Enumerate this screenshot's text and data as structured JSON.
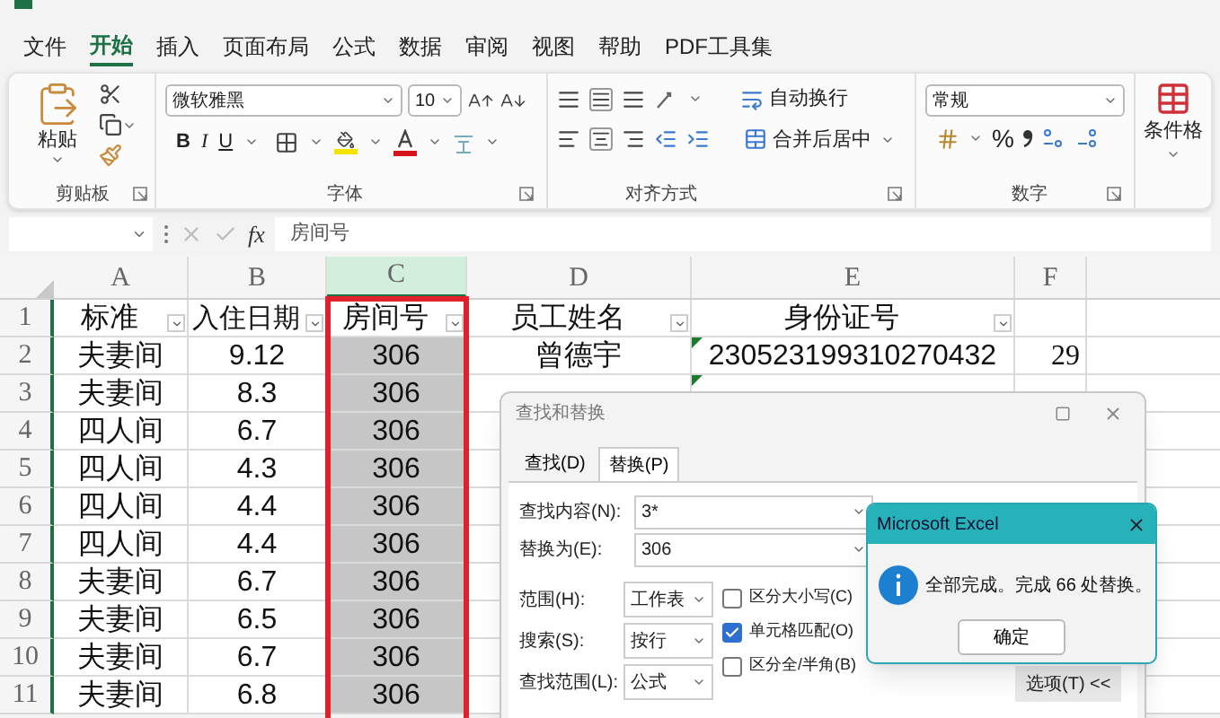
{
  "menu_tabs": [
    {
      "label": "文件",
      "selected": false
    },
    {
      "label": "开始",
      "selected": true
    },
    {
      "label": "插入",
      "selected": false
    },
    {
      "label": "页面布局",
      "selected": false
    },
    {
      "label": "公式",
      "selected": false
    },
    {
      "label": "数据",
      "selected": false
    },
    {
      "label": "审阅",
      "selected": false
    },
    {
      "label": "视图",
      "selected": false
    },
    {
      "label": "帮助",
      "selected": false
    },
    {
      "label": "PDF工具集",
      "selected": false
    }
  ],
  "ribbon": {
    "clipboard": {
      "paste": "粘贴",
      "group": "剪贴板"
    },
    "font": {
      "font_name": "微软雅黑",
      "font_size": "10",
      "bold": "B",
      "italic": "I",
      "underline": "U",
      "group": "字体"
    },
    "alignment": {
      "wrap": "自动换行",
      "merge": "合并后居中",
      "group": "对齐方式"
    },
    "number": {
      "format": "常规",
      "percent": "%",
      "group": "数字"
    },
    "styles": {
      "conditional": "条件格"
    }
  },
  "formula_bar": {
    "fx": "fx",
    "value": "房间号"
  },
  "sheet": {
    "columns": [
      {
        "label": "A",
        "selected": false
      },
      {
        "label": "B",
        "selected": false
      },
      {
        "label": "C",
        "selected": true
      },
      {
        "label": "D",
        "selected": false
      },
      {
        "label": "E",
        "selected": false
      },
      {
        "label": "F",
        "selected": false
      }
    ],
    "header_row": {
      "num": "1",
      "filter": true,
      "cells": [
        "标准",
        "入住日期",
        "房间号",
        "员工姓名",
        "身份证号"
      ]
    },
    "rows": [
      {
        "num": "2",
        "error_mark": true,
        "cells": [
          "夫妻间",
          "9.12",
          "306",
          "曾德宇",
          "230523199310270432",
          "29"
        ]
      },
      {
        "num": "3",
        "error_mark": true,
        "cells": [
          "夫妻间",
          "8.3",
          "306"
        ]
      },
      {
        "num": "4",
        "cells": [
          "四人间",
          "6.7",
          "306"
        ]
      },
      {
        "num": "5",
        "cells": [
          "四人间",
          "4.3",
          "306"
        ]
      },
      {
        "num": "6",
        "cells": [
          "四人间",
          "4.4",
          "306"
        ]
      },
      {
        "num": "7",
        "cells": [
          "四人间",
          "4.4",
          "306"
        ]
      },
      {
        "num": "8",
        "cells": [
          "夫妻间",
          "6.7",
          "306"
        ]
      },
      {
        "num": "9",
        "cells": [
          "夫妻间",
          "6.5",
          "306"
        ]
      },
      {
        "num": "10",
        "cells": [
          "夫妻间",
          "6.7",
          "306"
        ]
      },
      {
        "num": "11",
        "cells": [
          "夫妻间",
          "6.8",
          "306"
        ]
      }
    ]
  },
  "find_dialog": {
    "title": "查找和替换",
    "tabs": [
      {
        "label": "查找(D)",
        "selected": false
      },
      {
        "label": "替换(P)",
        "selected": true
      }
    ],
    "find_label": "查找内容(N):",
    "find_value": "3*",
    "replace_label": "替换为(E):",
    "replace_value": "306",
    "options": [
      {
        "label": "范围(H):",
        "value": "工作表"
      },
      {
        "label": "搜索(S):",
        "value": "按行"
      },
      {
        "label": "查找范围(L):",
        "value": "公式"
      }
    ],
    "checkboxes": [
      {
        "label": "区分大小写(C)",
        "checked": false
      },
      {
        "label": "单元格匹配(O)",
        "checked": true
      },
      {
        "label": "区分全/半角(B)",
        "checked": false
      }
    ],
    "options_button": "选项(T) <<"
  },
  "message_box": {
    "title": "Microsoft Excel",
    "text": "全部完成。完成 66 处替换。",
    "button": "确定"
  }
}
